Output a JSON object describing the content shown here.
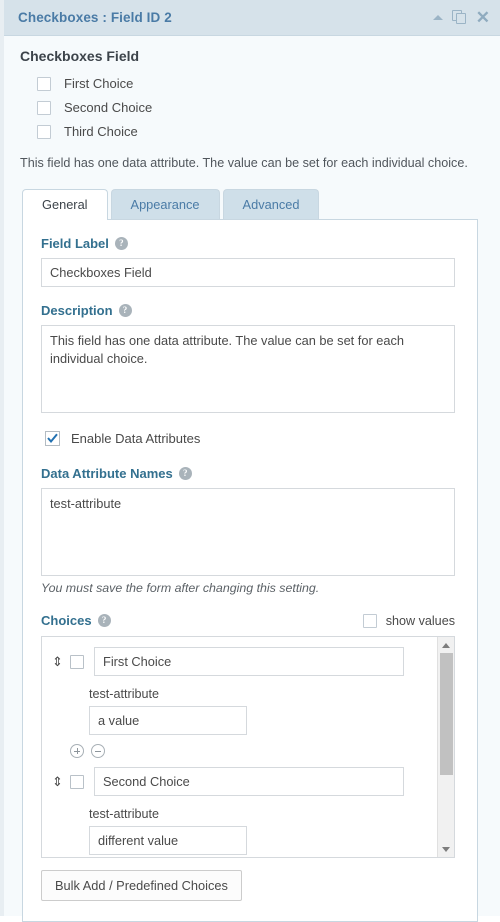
{
  "header": {
    "title": "Checkboxes : Field ID 2",
    "icons": {
      "collapse": "caret-up-icon",
      "duplicate": "duplicate-icon",
      "close": "close-icon"
    },
    "colors": {
      "bar": "#d6e2ea",
      "title_text": "#4a7ba6",
      "icon": "#9bb4c6"
    }
  },
  "preview": {
    "title": "Checkboxes Field",
    "choices": [
      {
        "label": "First Choice",
        "checked": false
      },
      {
        "label": "Second Choice",
        "checked": false
      },
      {
        "label": "Third Choice",
        "checked": false
      }
    ],
    "description": "This field has one data attribute. The value can be set for each individual choice."
  },
  "tabs": [
    {
      "label": "General",
      "active": true
    },
    {
      "label": "Appearance",
      "active": false
    },
    {
      "label": "Advanced",
      "active": false
    }
  ],
  "general": {
    "field_label": {
      "label": "Field Label",
      "help": "help-icon",
      "value": "Checkboxes Field"
    },
    "description": {
      "label": "Description",
      "help": "help-icon",
      "value": "This field has one data attribute. The value can be set for each individual choice."
    },
    "enable_data_attributes": {
      "label": "Enable Data Attributes",
      "checked": true
    },
    "data_attribute_names": {
      "label": "Data Attribute Names",
      "help": "help-icon",
      "value": "test-attribute",
      "hint": "You must save the form after changing this setting."
    },
    "choices": {
      "label": "Choices",
      "help": "help-icon",
      "show_values_label": "show values",
      "show_values_checked": false,
      "items": [
        {
          "label": "First Choice",
          "checked": false,
          "attribute_name": "test-attribute",
          "attribute_value": "a value"
        },
        {
          "label": "Second Choice",
          "checked": false,
          "attribute_name": "test-attribute",
          "attribute_value": "different value"
        }
      ],
      "add_icon": "plus-circle-icon",
      "remove_icon": "minus-circle-icon",
      "drag_icon": "drag-handle-icon"
    },
    "bulk_add_button": "Bulk Add / Predefined Choices"
  }
}
